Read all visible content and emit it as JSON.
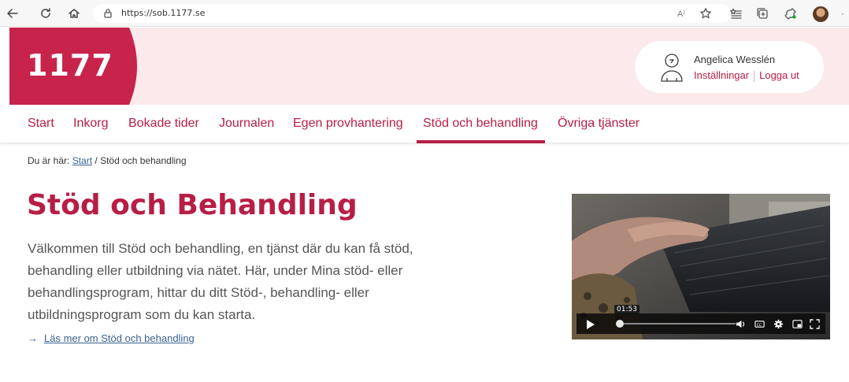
{
  "browser": {
    "url": "https://sob.1177.se",
    "read_aloud_label": "A⁾",
    "more_label": "·"
  },
  "header": {
    "logo_text": "1177",
    "user_name": "Angelica Wesslén",
    "settings_label": "Inställningar",
    "logout_label": "Logga ut"
  },
  "nav": {
    "items": [
      {
        "label": "Start"
      },
      {
        "label": "Inkorg"
      },
      {
        "label": "Bokade tider"
      },
      {
        "label": "Journalen"
      },
      {
        "label": "Egen provhantering"
      },
      {
        "label": "Stöd och behandling"
      },
      {
        "label": "Övriga tjänster"
      }
    ],
    "active_index": 5
  },
  "breadcrumb": {
    "prefix": "Du är här:",
    "start": "Start",
    "separator": "/",
    "current": "Stöd och behandling"
  },
  "main": {
    "title": "Stöd och Behandling",
    "intro": "Välkommen till Stöd och behandling, en tjänst där du kan få stöd, behandling eller utbildning via nätet. Här, under Mina stöd- eller behandlingsprogram, hittar du ditt Stöd-, behandling- eller utbildningsprogram som du kan starta.",
    "read_more_arrow": "→",
    "read_more": "Läs mer om Stöd och behandling"
  },
  "video": {
    "time": "01:53",
    "progress_fraction": 0.02
  },
  "colors": {
    "brand": "#b71e45",
    "header_bg": "#fbe9ec",
    "link": "#396291"
  }
}
